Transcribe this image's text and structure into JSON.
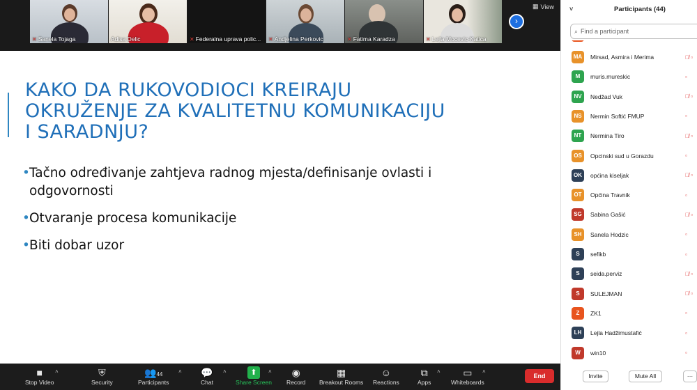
{
  "gallery": {
    "view_label": "View",
    "participants": [
      {
        "name": "Sanela Tojaga",
        "muted": true
      },
      {
        "name": "Adisa Delic",
        "muted": false
      },
      {
        "name": "Federalna uprava polic...",
        "muted": true
      },
      {
        "name": "Andjelina Perkovic",
        "muted": true
      },
      {
        "name": "Fatima Karadza",
        "muted": true
      },
      {
        "name": "Lejla Mocevic-Katica",
        "muted": true
      }
    ]
  },
  "slide": {
    "title": "KAKO DA RUKOVODIOCI KREIRAJU OKRUŽENJE ZA KVALITETNU KOMUNIKACIJU I SARADNJU?",
    "bullets": [
      "Tačno određivanje zahtjeva radnog mjesta/definisanje ovlasti i odgovornosti",
      "Otvaranje procesa komunikacije",
      "Biti dobar uzor"
    ]
  },
  "toolbar": {
    "stop_video": "Stop Video",
    "security": "Security",
    "participants": "Participants",
    "participants_count": "44",
    "chat": "Chat",
    "share_screen": "Share Screen",
    "record": "Record",
    "breakout_rooms": "Breakout Rooms",
    "reactions": "Reactions",
    "apps": "Apps",
    "whiteboards": "Whiteboards",
    "end": "End"
  },
  "panel": {
    "title": "Participants (44)",
    "search_placeholder": "Find a participant",
    "participants": [
      {
        "initials": "MA",
        "name": "Mirsad, Asmira i Merima",
        "color": "#e8922a",
        "muted": true
      },
      {
        "initials": "M",
        "name": "muris.mureskic",
        "color": "#2ea44f",
        "muted": false
      },
      {
        "initials": "NV",
        "name": "Nedžad Vuk",
        "color": "#2ea44f",
        "muted": true
      },
      {
        "initials": "NS",
        "name": "Nermin Softić FMUP",
        "color": "#e8922a",
        "muted": false
      },
      {
        "initials": "NT",
        "name": "Nermina Tiro",
        "color": "#2ea44f",
        "muted": true
      },
      {
        "initials": "OS",
        "name": "Opcinski sud u Gorazdu",
        "color": "#e8922a",
        "muted": false
      },
      {
        "initials": "OK",
        "name": "općina kiseljak",
        "color": "#2e4057",
        "muted": true
      },
      {
        "initials": "OT",
        "name": "Općina Travnik",
        "color": "#e8922a",
        "muted": false
      },
      {
        "initials": "SG",
        "name": "Sabina Gašić",
        "color": "#c0392b",
        "muted": true
      },
      {
        "initials": "SH",
        "name": "Sanela Hodzic",
        "color": "#e8922a",
        "muted": false
      },
      {
        "initials": "S",
        "name": "sefikb",
        "color": "#2e4057",
        "muted": false
      },
      {
        "initials": "S",
        "name": "seida.perviz",
        "color": "#2e4057",
        "muted": true
      },
      {
        "initials": "S",
        "name": "SULEJMAN",
        "color": "#c0392b",
        "muted": true
      },
      {
        "initials": "Z",
        "name": "ZK1",
        "color": "#e8541e",
        "muted": false
      },
      {
        "initials": "LH",
        "name": "Lejla Hadžimustafić",
        "color": "#2e4057",
        "muted": false
      },
      {
        "initials": "W",
        "name": "win10",
        "color": "#c0392b",
        "muted": false
      }
    ],
    "invite": "Invite",
    "mute_all": "Mute All",
    "more": "···"
  }
}
